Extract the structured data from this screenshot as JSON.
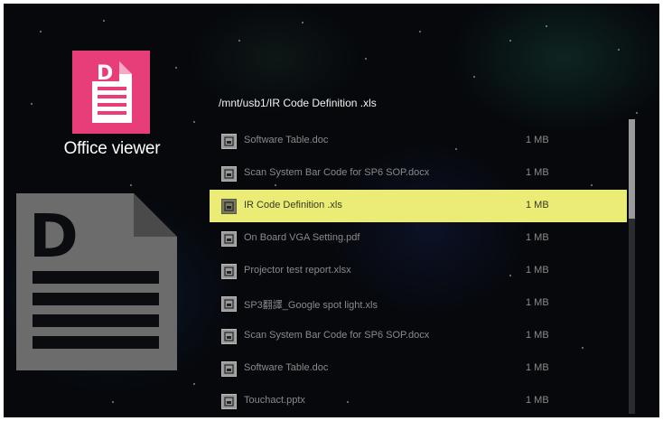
{
  "app": {
    "title": "Office viewer",
    "icon": "document-icon",
    "accent": "#e73d78"
  },
  "browser": {
    "path": "/mnt/usb1/IR Code Definition .xls",
    "selected_index": 2,
    "highlight_color": "#eaec76",
    "files": [
      {
        "name": "Software Table.doc",
        "size": "1 MB"
      },
      {
        "name": "Scan System Bar Code for SP6 SOP.docx",
        "size": "1 MB"
      },
      {
        "name": "IR Code Definition .xls",
        "size": "1 MB"
      },
      {
        "name": "On Board VGA Setting.pdf",
        "size": "1 MB"
      },
      {
        "name": "Projector test report.xlsx",
        "size": "1 MB"
      },
      {
        "name": "SP3翻譯_Google spot light.xls",
        "size": "1 MB"
      },
      {
        "name": "Scan System Bar Code for SP6 SOP.docx",
        "size": "1 MB"
      },
      {
        "name": "Software Table.doc",
        "size": "1 MB"
      },
      {
        "name": "Touchact.pptx",
        "size": "1 MB"
      }
    ]
  }
}
